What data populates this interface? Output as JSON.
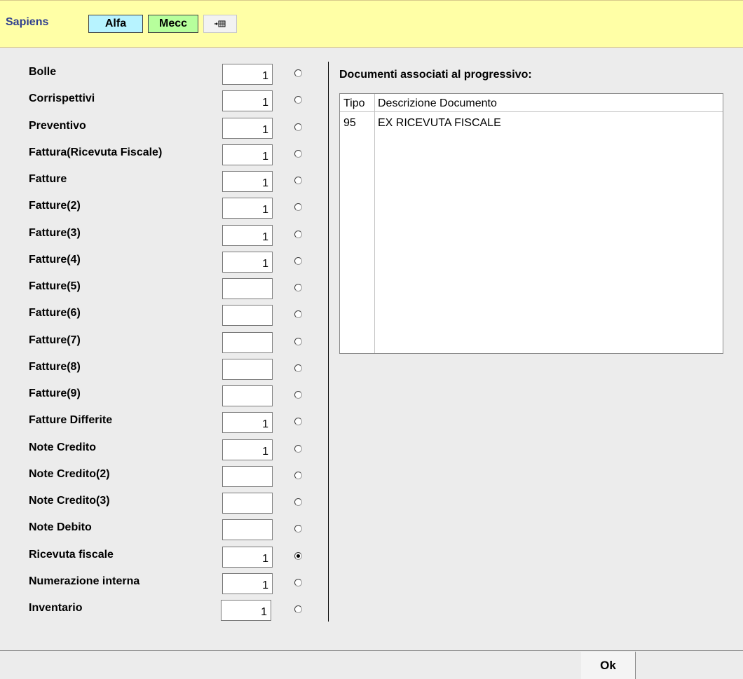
{
  "toolbar": {
    "app_name": "Sapiens",
    "alfa_label": "Alfa",
    "mecc_label": "Mecc",
    "export_icon": "export-grid-icon"
  },
  "rows": [
    {
      "label": "Bolle",
      "value": "1",
      "selected": false
    },
    {
      "label": "Corrispettivi",
      "value": "1",
      "selected": false
    },
    {
      "label": "Preventivo",
      "value": "1",
      "selected": false
    },
    {
      "label": "Fattura(Ricevuta Fiscale)",
      "value": "1",
      "selected": false
    },
    {
      "label": "Fatture",
      "value": "1",
      "selected": false
    },
    {
      "label": "Fatture(2)",
      "value": "1",
      "selected": false
    },
    {
      "label": "Fatture(3)",
      "value": "1",
      "selected": false
    },
    {
      "label": "Fatture(4)",
      "value": "1",
      "selected": false
    },
    {
      "label": "Fatture(5)",
      "value": "",
      "selected": false
    },
    {
      "label": "Fatture(6)",
      "value": "",
      "selected": false
    },
    {
      "label": "Fatture(7)",
      "value": "",
      "selected": false
    },
    {
      "label": "Fatture(8)",
      "value": "",
      "selected": false
    },
    {
      "label": "Fatture(9)",
      "value": "",
      "selected": false
    },
    {
      "label": "Fatture Differite",
      "value": "1",
      "selected": false
    },
    {
      "label": "Note Credito",
      "value": "1",
      "selected": false
    },
    {
      "label": "Note Credito(2)",
      "value": "",
      "selected": false
    },
    {
      "label": "Note Credito(3)",
      "value": "",
      "selected": false
    },
    {
      "label": "Note Debito",
      "value": "",
      "selected": false
    },
    {
      "label": "Ricevuta fiscale",
      "value": "1",
      "selected": true
    },
    {
      "label": "Numerazione interna",
      "value": "1",
      "selected": false
    },
    {
      "label": "Inventario",
      "value": "1",
      "selected": false
    }
  ],
  "documents": {
    "title": "Documenti associati al progressivo:",
    "headers": [
      "Tipo",
      "Descrizione Documento"
    ],
    "rows": [
      {
        "tipo": "95",
        "descrizione": "EX RICEVUTA FISCALE"
      }
    ]
  },
  "footer": {
    "ok_label": "Ok"
  }
}
